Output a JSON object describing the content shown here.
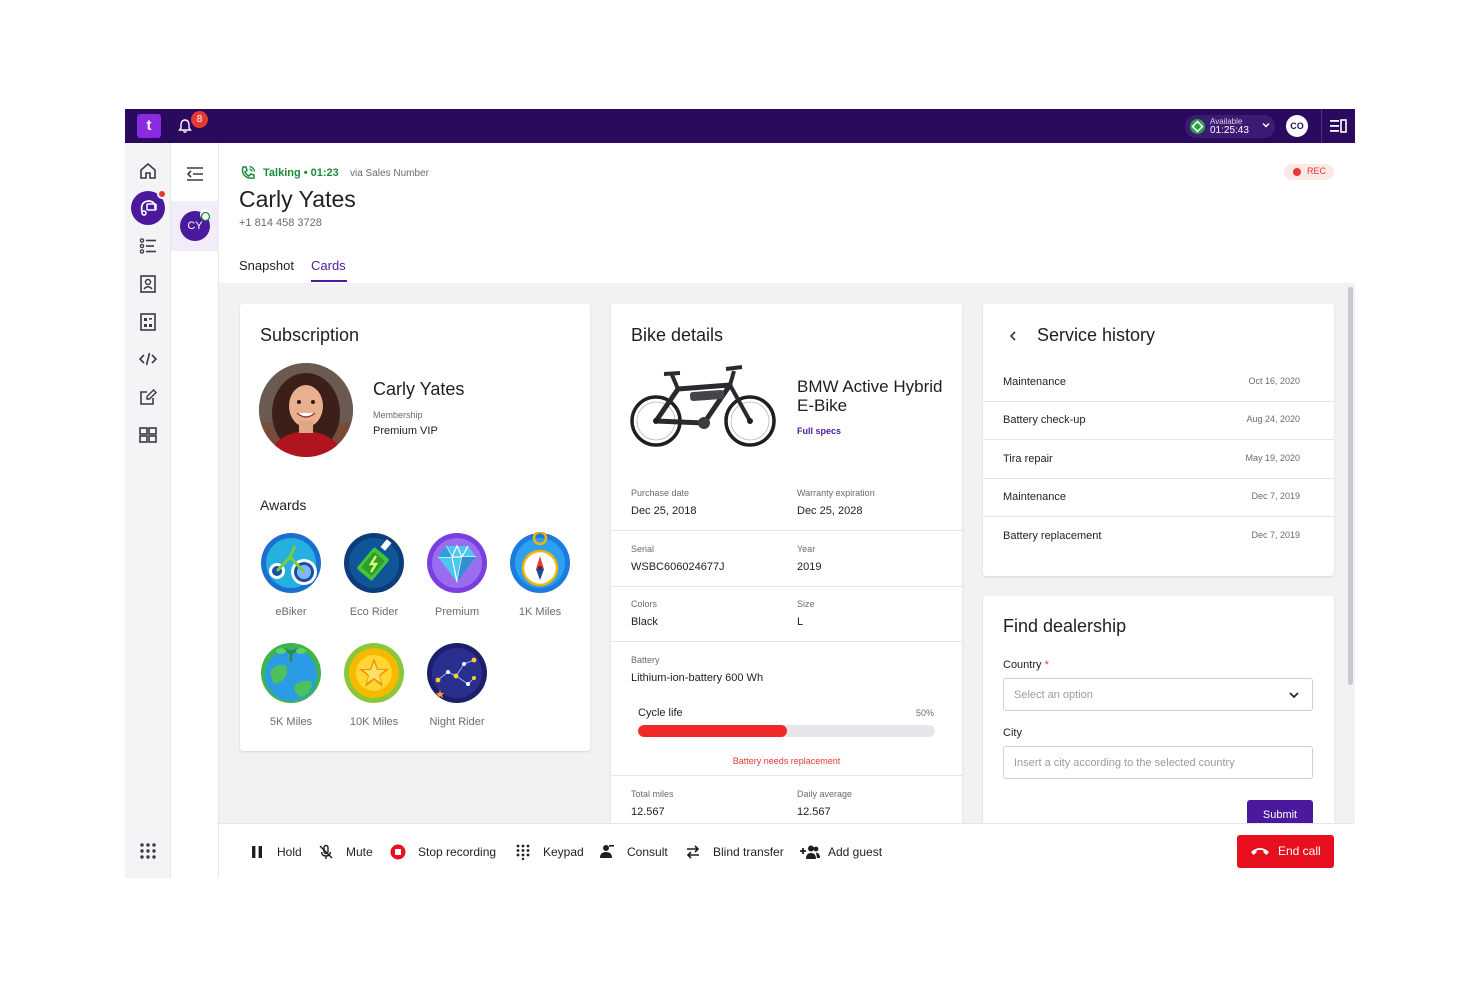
{
  "topbar": {
    "logo": "t",
    "notification_count": "8",
    "status_label": "Available",
    "status_time": "01:25:43",
    "user_initials": "CO"
  },
  "call": {
    "status": "Talking • 01:23",
    "via": "via Sales Number",
    "caller_name": "Carly Yates",
    "caller_phone": "+1 814 458 3728",
    "caller_initials": "CY",
    "rec_label": "REC"
  },
  "tabs": [
    "Snapshot",
    "Cards"
  ],
  "active_tab": "Cards",
  "subscription": {
    "title": "Subscription",
    "name": "Carly Yates",
    "membership_label": "Membership",
    "membership_value": "Premium VIP",
    "awards_title": "Awards",
    "awards": [
      {
        "label": "eBiker",
        "icon": "bike-award-icon"
      },
      {
        "label": "Eco Rider",
        "icon": "battery-award-icon"
      },
      {
        "label": "Premium",
        "icon": "diamond-award-icon"
      },
      {
        "label": "1K Miles",
        "icon": "compass-award-icon"
      },
      {
        "label": "5K Miles",
        "icon": "earth-award-icon"
      },
      {
        "label": "10K Miles",
        "icon": "star-award-icon"
      },
      {
        "label": "Night Rider",
        "icon": "constellation-award-icon"
      }
    ]
  },
  "bike": {
    "title": "Bike details",
    "name": "BMW Active Hybrid E-Bike",
    "full_specs": "Full specs",
    "purchase_date_label": "Purchase date",
    "purchase_date": "Dec 25, 2018",
    "warranty_label": "Warranty expiration",
    "warranty": "Dec 25, 2028",
    "serial_label": "Serial",
    "serial": "WSBC606024677J",
    "year_label": "Year",
    "year": "2019",
    "colors_label": "Colors",
    "colors": "Black",
    "size_label": "Size",
    "size": "L",
    "battery_label": "Battery",
    "battery": "Lithium-ion-battery 600 Wh",
    "cycle_life_label": "Cycle life",
    "cycle_life_pct_label": "50%",
    "cycle_life_fraction": 0.5,
    "battery_warning": "Battery needs replacement",
    "total_miles_label": "Total miles",
    "total_miles": "12.567",
    "daily_avg_label": "Daily average",
    "daily_avg": "12.567"
  },
  "service": {
    "title": "Service history",
    "items": [
      {
        "name": "Maintenance",
        "date": "Oct 16, 2020"
      },
      {
        "name": "Battery check-up",
        "date": "Aug 24, 2020"
      },
      {
        "name": "Tira repair",
        "date": "May 19, 2020"
      },
      {
        "name": "Maintenance",
        "date": "Dec 7, 2019"
      },
      {
        "name": "Battery replacement",
        "date": "Dec 7, 2019"
      }
    ]
  },
  "dealership": {
    "title": "Find dealership",
    "country_label": "Country",
    "country_required": "*",
    "country_placeholder": "Select an option",
    "city_label": "City",
    "city_placeholder": "Insert a city according to the selected country",
    "submit_label": "Submit"
  },
  "controls": {
    "hold": "Hold",
    "mute": "Mute",
    "stop_recording": "Stop recording",
    "keypad": "Keypad",
    "consult": "Consult",
    "blind_transfer": "Blind transfer",
    "add_guest": "Add guest",
    "end_call": "End call"
  },
  "colors": {
    "topbar": "#2a0a5e",
    "accent": "#4b1a9c",
    "talking": "#1b8a3a",
    "danger": "#e8101e",
    "progress": "#f02828"
  }
}
